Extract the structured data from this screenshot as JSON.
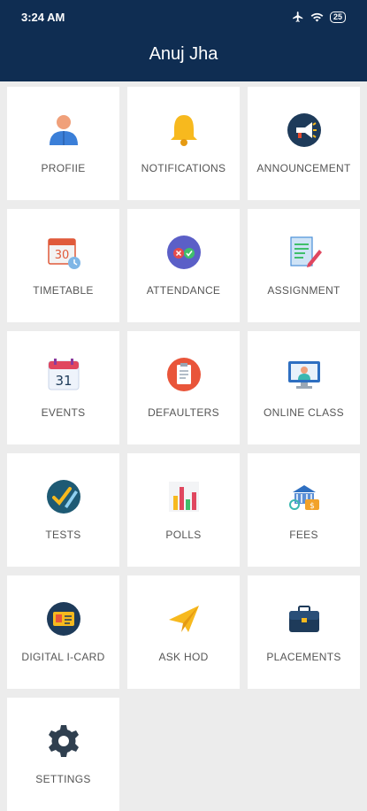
{
  "status_bar": {
    "time": "3:24 AM",
    "battery": "25"
  },
  "header": {
    "title": "Anuj Jha"
  },
  "tiles": [
    {
      "label": "PROFIIE",
      "icon": "profile-icon"
    },
    {
      "label": "NOTIFICATIONS",
      "icon": "bell-icon"
    },
    {
      "label": "ANNOUNCEMENT",
      "icon": "megaphone-icon"
    },
    {
      "label": "TIMETABLE",
      "icon": "calendar-clock-icon"
    },
    {
      "label": "ATTENDANCE",
      "icon": "attendance-icon"
    },
    {
      "label": "ASSIGNMENT",
      "icon": "assignment-icon"
    },
    {
      "label": "EVENTS",
      "icon": "calendar-icon"
    },
    {
      "label": "DEFAULTERS",
      "icon": "clipboard-icon"
    },
    {
      "label": "ONLINE CLASS",
      "icon": "online-class-icon"
    },
    {
      "label": "TESTS",
      "icon": "test-icon"
    },
    {
      "label": "POLLS",
      "icon": "polls-icon"
    },
    {
      "label": "FEES",
      "icon": "fees-icon"
    },
    {
      "label": "DIGITAL I-CARD",
      "icon": "id-card-icon"
    },
    {
      "label": "ASK HOD",
      "icon": "paper-plane-icon"
    },
    {
      "label": "PLACEMENTS",
      "icon": "briefcase-icon"
    },
    {
      "label": "SETTINGS",
      "icon": "gear-icon"
    }
  ]
}
